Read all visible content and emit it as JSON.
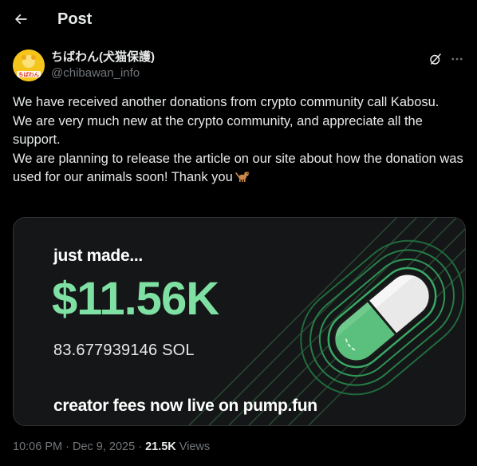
{
  "header": {
    "title": "Post",
    "back_icon": "arrow-left-icon"
  },
  "author": {
    "display_name": "ちばわん(犬猫保護)",
    "handle": "@chibawan_info",
    "avatar_text": "ちばわん",
    "avatar_color": "#f3c21b"
  },
  "actions": {
    "grok_icon": "grok-icon",
    "more_icon": "more-dots-icon"
  },
  "post": {
    "lines": [
      "We have received another donations from crypto community call Kabosu.",
      "We are very much new at the crypto community, and appreciate all the support.",
      "We are planning to release the article on our site about how the donation was used for our animals soon! Thank you"
    ],
    "emoji": "dog-emoji"
  },
  "media": {
    "headline": "just made...",
    "amount": "$11.56K",
    "sol": "83.677939146 SOL",
    "footer": "creator fees now live on pump.fun",
    "accent_color": "#7ee0a3"
  },
  "meta": {
    "time": "10:06 PM",
    "separator": " · ",
    "date": "Dec 9, 2025",
    "views_count": "21.5K",
    "views_label": " Views"
  }
}
